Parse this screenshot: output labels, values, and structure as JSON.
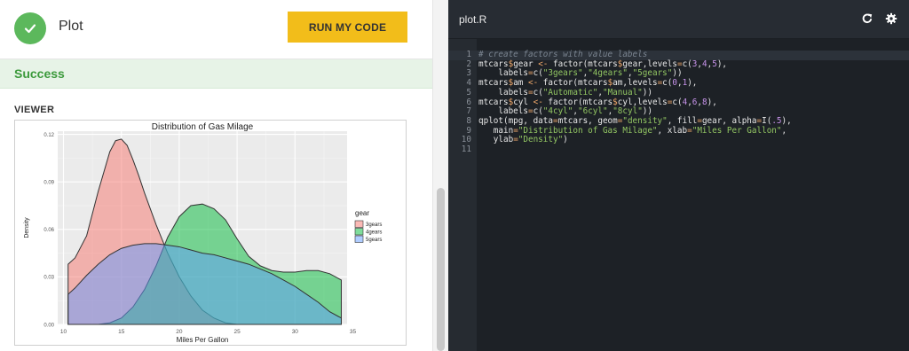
{
  "header": {
    "title": "Plot",
    "run_button": "RUN MY CODE"
  },
  "status": {
    "label": "Success"
  },
  "viewer": {
    "label": "VIEWER"
  },
  "chart_data": {
    "type": "area",
    "title": "Distribution of Gas Milage",
    "xlabel": "Miles Per Gallon",
    "ylabel": "Density",
    "xlim": [
      9.5,
      34.5
    ],
    "ylim": [
      0,
      0.122
    ],
    "xticks": [
      "10",
      "15",
      "20",
      "25",
      "30",
      "35"
    ],
    "yticks": [
      "0.00",
      "0.03",
      "0.06",
      "0.09",
      "0.12"
    ],
    "grid": true,
    "legend_title": "gear",
    "legend_position": "right",
    "series": [
      {
        "name": "3gears",
        "color": "#f8766d",
        "fill_opacity": 0.5,
        "x": [
          10.4,
          11,
          12,
          13,
          14,
          14.5,
          15,
          15.5,
          16,
          16.5,
          17,
          18,
          19,
          20,
          21,
          22,
          23,
          24,
          25,
          26,
          27,
          28,
          29,
          30,
          31,
          32,
          33,
          34
        ],
        "y": [
          0.038,
          0.042,
          0.056,
          0.084,
          0.109,
          0.116,
          0.117,
          0.113,
          0.104,
          0.094,
          0.083,
          0.063,
          0.045,
          0.03,
          0.018,
          0.009,
          0.004,
          0.001,
          0,
          0,
          0,
          0,
          0,
          0,
          0,
          0,
          0,
          0
        ]
      },
      {
        "name": "4gears",
        "color": "#00ba38",
        "fill_opacity": 0.5,
        "x": [
          10.4,
          11,
          12,
          13,
          14,
          15,
          16,
          17,
          18,
          19,
          20,
          21,
          22,
          23,
          24,
          25,
          26,
          27,
          28,
          29,
          30,
          31,
          32,
          33,
          34
        ],
        "y": [
          0,
          0,
          0,
          0,
          0.001,
          0.004,
          0.011,
          0.022,
          0.037,
          0.055,
          0.068,
          0.075,
          0.076,
          0.073,
          0.066,
          0.054,
          0.043,
          0.037,
          0.034,
          0.033,
          0.033,
          0.034,
          0.034,
          0.032,
          0.028
        ]
      },
      {
        "name": "5gears",
        "color": "#619cff",
        "fill_opacity": 0.5,
        "x": [
          10.4,
          11,
          12,
          13,
          14,
          15,
          16,
          17,
          18,
          19,
          20,
          21,
          22,
          23,
          24,
          25,
          26,
          27,
          28,
          29,
          30,
          31,
          32,
          33,
          34
        ],
        "y": [
          0.019,
          0.023,
          0.031,
          0.038,
          0.044,
          0.048,
          0.05,
          0.051,
          0.051,
          0.05,
          0.049,
          0.047,
          0.045,
          0.044,
          0.042,
          0.04,
          0.038,
          0.035,
          0.032,
          0.028,
          0.024,
          0.019,
          0.014,
          0.008,
          0.004
        ]
      }
    ]
  },
  "editor": {
    "filename": "plot.R",
    "reload_icon": "reload-icon",
    "settings_icon": "gear-icon",
    "lines": [
      [
        {
          "t": "# create factors with value labels",
          "c": "c-cmt"
        }
      ],
      [
        {
          "t": "mtcars",
          "c": "c-def"
        },
        {
          "t": "$",
          "c": "c-op"
        },
        {
          "t": "gear ",
          "c": "c-def"
        },
        {
          "t": "<-",
          "c": "c-op"
        },
        {
          "t": " factor(mtcars",
          "c": "c-def"
        },
        {
          "t": "$",
          "c": "c-op"
        },
        {
          "t": "gear,levels",
          "c": "c-def"
        },
        {
          "t": "=",
          "c": "c-op"
        },
        {
          "t": "c(",
          "c": "c-def"
        },
        {
          "t": "3",
          "c": "c-num"
        },
        {
          "t": ",",
          "c": "c-def"
        },
        {
          "t": "4",
          "c": "c-num"
        },
        {
          "t": ",",
          "c": "c-def"
        },
        {
          "t": "5",
          "c": "c-num"
        },
        {
          "t": "),",
          "c": "c-def"
        }
      ],
      [
        {
          "t": "    labels",
          "c": "c-def"
        },
        {
          "t": "=",
          "c": "c-op"
        },
        {
          "t": "c(",
          "c": "c-def"
        },
        {
          "t": "\"3gears\"",
          "c": "c-str"
        },
        {
          "t": ",",
          "c": "c-def"
        },
        {
          "t": "\"4gears\"",
          "c": "c-str"
        },
        {
          "t": ",",
          "c": "c-def"
        },
        {
          "t": "\"5gears\"",
          "c": "c-str"
        },
        {
          "t": "))",
          "c": "c-def"
        }
      ],
      [
        {
          "t": "mtcars",
          "c": "c-def"
        },
        {
          "t": "$",
          "c": "c-op"
        },
        {
          "t": "am ",
          "c": "c-def"
        },
        {
          "t": "<-",
          "c": "c-op"
        },
        {
          "t": " factor(mtcars",
          "c": "c-def"
        },
        {
          "t": "$",
          "c": "c-op"
        },
        {
          "t": "am,levels",
          "c": "c-def"
        },
        {
          "t": "=",
          "c": "c-op"
        },
        {
          "t": "c(",
          "c": "c-def"
        },
        {
          "t": "0",
          "c": "c-num"
        },
        {
          "t": ",",
          "c": "c-def"
        },
        {
          "t": "1",
          "c": "c-num"
        },
        {
          "t": "),",
          "c": "c-def"
        }
      ],
      [
        {
          "t": "    labels",
          "c": "c-def"
        },
        {
          "t": "=",
          "c": "c-op"
        },
        {
          "t": "c(",
          "c": "c-def"
        },
        {
          "t": "\"Automatic\"",
          "c": "c-str"
        },
        {
          "t": ",",
          "c": "c-def"
        },
        {
          "t": "\"Manual\"",
          "c": "c-str"
        },
        {
          "t": "))",
          "c": "c-def"
        }
      ],
      [
        {
          "t": "mtcars",
          "c": "c-def"
        },
        {
          "t": "$",
          "c": "c-op"
        },
        {
          "t": "cyl ",
          "c": "c-def"
        },
        {
          "t": "<-",
          "c": "c-op"
        },
        {
          "t": " factor(mtcars",
          "c": "c-def"
        },
        {
          "t": "$",
          "c": "c-op"
        },
        {
          "t": "cyl,levels",
          "c": "c-def"
        },
        {
          "t": "=",
          "c": "c-op"
        },
        {
          "t": "c(",
          "c": "c-def"
        },
        {
          "t": "4",
          "c": "c-num"
        },
        {
          "t": ",",
          "c": "c-def"
        },
        {
          "t": "6",
          "c": "c-num"
        },
        {
          "t": ",",
          "c": "c-def"
        },
        {
          "t": "8",
          "c": "c-num"
        },
        {
          "t": "),",
          "c": "c-def"
        }
      ],
      [
        {
          "t": "    labels",
          "c": "c-def"
        },
        {
          "t": "=",
          "c": "c-op"
        },
        {
          "t": "c(",
          "c": "c-def"
        },
        {
          "t": "\"4cyl\"",
          "c": "c-str"
        },
        {
          "t": ",",
          "c": "c-def"
        },
        {
          "t": "\"6cyl\"",
          "c": "c-str"
        },
        {
          "t": ",",
          "c": "c-def"
        },
        {
          "t": "\"8cyl\"",
          "c": "c-str"
        },
        {
          "t": "))",
          "c": "c-def"
        }
      ],
      [
        {
          "t": "qplot(mpg, data",
          "c": "c-def"
        },
        {
          "t": "=",
          "c": "c-op"
        },
        {
          "t": "mtcars, geom",
          "c": "c-def"
        },
        {
          "t": "=",
          "c": "c-op"
        },
        {
          "t": "\"density\"",
          "c": "c-str"
        },
        {
          "t": ", fill",
          "c": "c-def"
        },
        {
          "t": "=",
          "c": "c-op"
        },
        {
          "t": "gear, alpha",
          "c": "c-def"
        },
        {
          "t": "=",
          "c": "c-op"
        },
        {
          "t": "I(",
          "c": "c-def"
        },
        {
          "t": ".5",
          "c": "c-num"
        },
        {
          "t": "),",
          "c": "c-def"
        }
      ],
      [
        {
          "t": "   main",
          "c": "c-def"
        },
        {
          "t": "=",
          "c": "c-op"
        },
        {
          "t": "\"Distribution of Gas Milage\"",
          "c": "c-str"
        },
        {
          "t": ", xlab",
          "c": "c-def"
        },
        {
          "t": "=",
          "c": "c-op"
        },
        {
          "t": "\"Miles Per Gallon\"",
          "c": "c-str"
        },
        {
          "t": ",",
          "c": "c-def"
        }
      ],
      [
        {
          "t": "   ylab",
          "c": "c-def"
        },
        {
          "t": "=",
          "c": "c-op"
        },
        {
          "t": "\"Density\"",
          "c": "c-str"
        },
        {
          "t": ")",
          "c": "c-def"
        }
      ],
      []
    ]
  }
}
